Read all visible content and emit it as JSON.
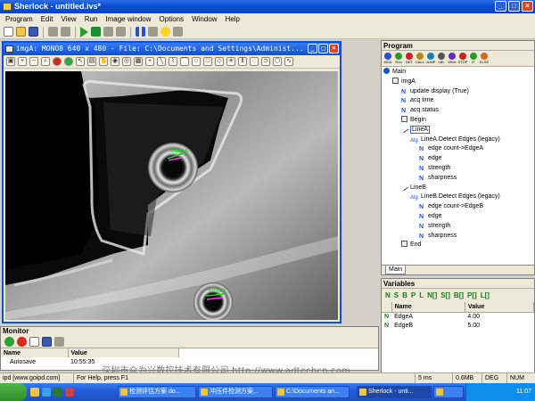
{
  "app": {
    "title": "Sherlock - untitled.ivs*"
  },
  "menu": [
    "Program",
    "Edit",
    "View",
    "Run",
    "Image window",
    "Options",
    "Window",
    "Help"
  ],
  "image_window": {
    "title": "imgA: MONO8 640 x 480 - File: C:\\Documents and Settings\\Administ...",
    "overlays": {
      "upper_label": "EdgeA",
      "lower_label": "EdgeB"
    }
  },
  "program": {
    "header": "Program",
    "icon_labels": [
      "MCA",
      "Run",
      "DET",
      "CALL",
      "JUMP",
      "LBL",
      "WhIe",
      "STOP",
      "IF",
      "ELSE"
    ],
    "tree": [
      {
        "indent": 0,
        "icon": "main-node-icon",
        "text": "Main"
      },
      {
        "indent": 1,
        "icon": "image-icon",
        "text": "imgA"
      },
      {
        "indent": 2,
        "icon": "instruction-icon",
        "text": "update display (True)"
      },
      {
        "indent": 2,
        "icon": "instruction-icon",
        "text": "acq time"
      },
      {
        "indent": 2,
        "icon": "instruction-icon",
        "text": "acq status"
      },
      {
        "indent": 2,
        "icon": "begin-icon",
        "text": "Begin"
      },
      {
        "indent": 2,
        "icon": "line-roi-icon",
        "text": "LineA",
        "highlight": true
      },
      {
        "indent": 3,
        "icon": "algorithm-icon",
        "text": "LineA.Detect Edges (legacy)"
      },
      {
        "indent": 4,
        "icon": "instruction-icon",
        "text": "edge count->EdgeA"
      },
      {
        "indent": 4,
        "icon": "instruction-icon",
        "text": "edge"
      },
      {
        "indent": 4,
        "icon": "instruction-icon",
        "text": "strength"
      },
      {
        "indent": 4,
        "icon": "instruction-icon",
        "text": "sharpness"
      },
      {
        "indent": 2,
        "icon": "line-roi-icon",
        "text": "LineB"
      },
      {
        "indent": 3,
        "icon": "algorithm-icon",
        "text": "LineB.Detect Edges (legacy)"
      },
      {
        "indent": 4,
        "icon": "instruction-icon",
        "text": "edge count->EdgeB"
      },
      {
        "indent": 4,
        "icon": "instruction-icon",
        "text": "edge"
      },
      {
        "indent": 4,
        "icon": "instruction-icon",
        "text": "strength"
      },
      {
        "indent": 4,
        "icon": "instruction-icon",
        "text": "sharpness"
      },
      {
        "indent": 2,
        "icon": "end-icon",
        "text": "End"
      }
    ],
    "tab": "Main"
  },
  "variables": {
    "header": "Variables",
    "type_buttons": [
      "N",
      "S",
      "B",
      "P",
      "L",
      "N[]",
      "S[]",
      "B[]",
      "P[]",
      "L[]"
    ],
    "columns": [
      "Name",
      "Value"
    ],
    "rows": [
      {
        "type": "N",
        "name": "EdgeA",
        "value": "4.00"
      },
      {
        "type": "N",
        "name": "EdgeB",
        "value": "5.00"
      }
    ]
  },
  "monitor": {
    "header": "Monitor",
    "columns": [
      "Name",
      "Value"
    ],
    "rows": [
      {
        "name": "Autosave",
        "value": "10:55:35"
      }
    ]
  },
  "watermark": "深圳市众为兴数控技术有限公司 http://www.adtechcn.com",
  "status": {
    "left": "ipd [www.goipd.com]",
    "help": "For Help, press F1",
    "ms": "5 ms",
    "mem": "0.6MB",
    "mode": "DEG",
    "num": "NUM"
  },
  "taskbar": {
    "items": [
      "检测评估方案 do...",
      "冲压件检测方案...",
      "C:\\Documents an...",
      "Sherlock - unti...",
      ""
    ],
    "clock": "11:07"
  },
  "colors": {
    "accent": "#0a53d8",
    "roi_green": "#22cc22",
    "roi_magenta": "#ff33ff"
  }
}
